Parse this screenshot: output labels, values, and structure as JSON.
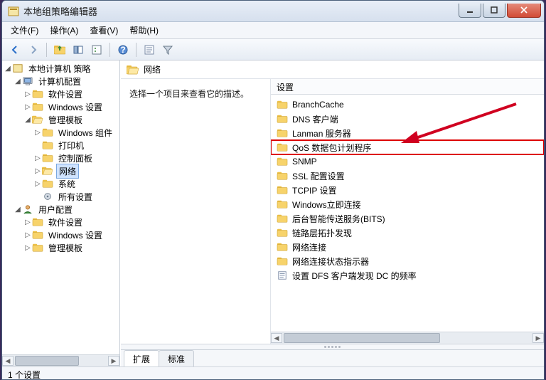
{
  "window_title": "本地组策略编辑器",
  "menu": {
    "file": "文件(F)",
    "action": "操作(A)",
    "view": "查看(V)",
    "help": "帮助(H)"
  },
  "tree": {
    "root": "本地计算机 策略",
    "computer": "计算机配置",
    "computer_children": {
      "software": "软件设置",
      "windows": "Windows 设置",
      "admin": "管理模板",
      "admin_children": {
        "components": "Windows 组件",
        "printers": "打印机",
        "panel": "控制面板",
        "network": "网络",
        "system": "系统",
        "all": "所有设置"
      }
    },
    "user": "用户配置",
    "user_children": {
      "software": "软件设置",
      "windows": "Windows 设置",
      "admin": "管理模板"
    }
  },
  "right": {
    "header": "网络",
    "desc": "选择一个项目来查看它的描述。",
    "colhead": "设置",
    "items": [
      {
        "label": "BranchCache",
        "type": "folder"
      },
      {
        "label": "DNS 客户端",
        "type": "folder"
      },
      {
        "label": "Lanman 服务器",
        "type": "folder"
      },
      {
        "label": "QoS 数据包计划程序",
        "type": "folder",
        "highlight": true
      },
      {
        "label": "SNMP",
        "type": "folder"
      },
      {
        "label": "SSL 配置设置",
        "type": "folder"
      },
      {
        "label": "TCPIP 设置",
        "type": "folder"
      },
      {
        "label": "Windows立即连接",
        "type": "folder"
      },
      {
        "label": "后台智能传送服务(BITS)",
        "type": "folder"
      },
      {
        "label": "链路层拓扑发现",
        "type": "folder"
      },
      {
        "label": "网络连接",
        "type": "folder"
      },
      {
        "label": "网络连接状态指示器",
        "type": "folder"
      },
      {
        "label": "设置 DFS 客户端发现 DC 的频率",
        "type": "setting"
      }
    ],
    "tabs": {
      "extended": "扩展",
      "standard": "标准"
    }
  },
  "status": "1 个设置",
  "colors": {
    "highlight": "#d00020"
  }
}
